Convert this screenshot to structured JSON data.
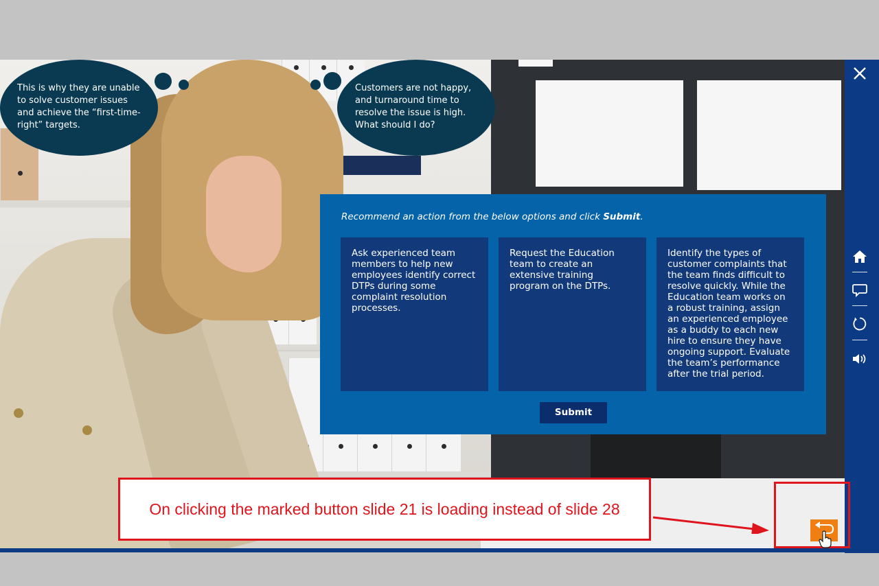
{
  "bubbles": {
    "left": "This is why they are unable to solve customer issues and achieve the “first-time-right” targets.",
    "right": "Customers are not happy, and turnaround time to resolve the issue is high. What should I do?"
  },
  "question": {
    "prompt_prefix": "Recommend an action from the below options and click ",
    "prompt_bold": "Submit",
    "prompt_suffix": ".",
    "options": [
      "Ask experienced team members to help new employees identify correct DTPs during some complaint resolution processes.",
      "Request the Education team to create an extensive training program on the DTPs.",
      "Identify the types of customer complaints that the team finds difficult to resolve quickly. While the Education team works on a robust training, assign an experienced employee as a buddy to each new hire to ensure they have ongoing support. Evaluate the team’s performance after the trial period."
    ],
    "submit_label": "Submit"
  },
  "nav": {
    "icons": [
      "close-icon",
      "home-icon",
      "transcript-icon",
      "replay-icon",
      "volume-icon"
    ]
  },
  "annotation": {
    "text": "On clicking the marked button slide 21 is loading instead of slide 28"
  },
  "colors": {
    "panel": "#0563aa",
    "option": "#12397a",
    "nav": "#0d3a85",
    "bubble": "#093a52",
    "back_button": "#f07f13",
    "annotation_red": "#e0141c"
  }
}
